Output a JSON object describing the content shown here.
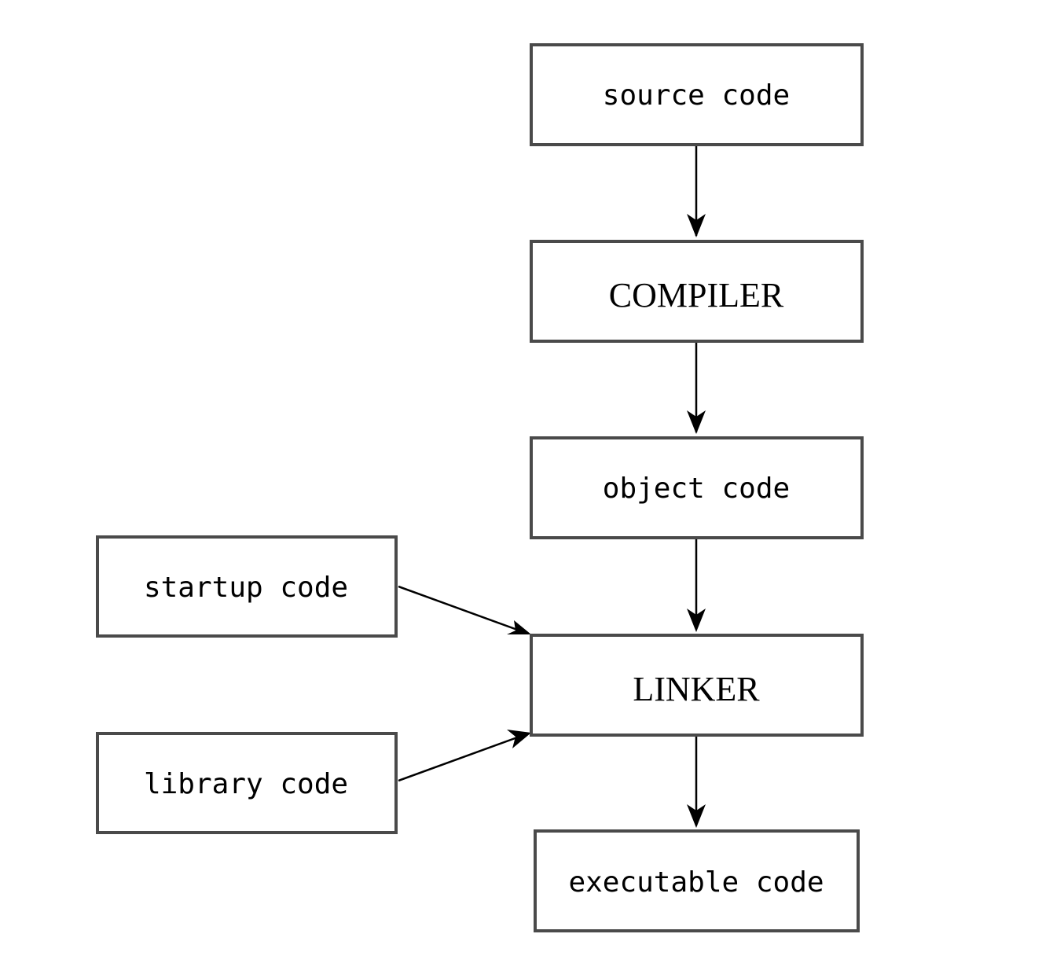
{
  "diagram": {
    "type": "flowchart",
    "nodes": [
      {
        "id": "source",
        "label": "source code",
        "style": "mono"
      },
      {
        "id": "compiler",
        "label": "COMPILER",
        "style": "serif"
      },
      {
        "id": "object",
        "label": "object code",
        "style": "mono"
      },
      {
        "id": "startup",
        "label": "startup code",
        "style": "mono"
      },
      {
        "id": "linker",
        "label": "LINKER",
        "style": "serif"
      },
      {
        "id": "library",
        "label": "library code",
        "style": "mono"
      },
      {
        "id": "executable",
        "label": "executable code",
        "style": "mono"
      }
    ],
    "edges": [
      {
        "from": "source",
        "to": "compiler"
      },
      {
        "from": "compiler",
        "to": "object"
      },
      {
        "from": "object",
        "to": "linker"
      },
      {
        "from": "startup",
        "to": "linker"
      },
      {
        "from": "library",
        "to": "linker"
      },
      {
        "from": "linker",
        "to": "executable"
      }
    ]
  }
}
